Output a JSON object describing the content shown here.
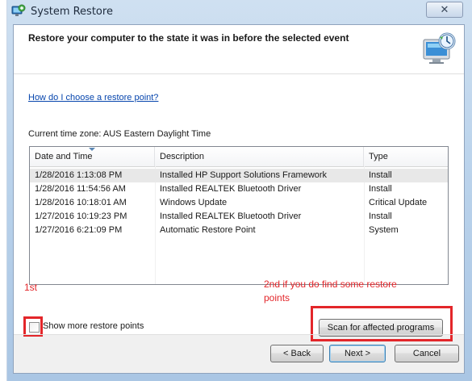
{
  "window": {
    "title": "System Restore",
    "close_glyph": "✕"
  },
  "header": {
    "title": "Restore your computer to the state it was in before the selected event"
  },
  "content": {
    "help_link": "How do I choose a restore point?",
    "timezone_label": "Current time zone: AUS Eastern Daylight Time"
  },
  "table": {
    "columns": [
      "Date and Time",
      "Description",
      "Type"
    ],
    "rows": [
      {
        "date": "1/28/2016 1:13:08 PM",
        "description": "Installed HP Support Solutions Framework",
        "type": "Install"
      },
      {
        "date": "1/28/2016 11:54:56 AM",
        "description": "Installed REALTEK Bluetooth Driver",
        "type": "Install"
      },
      {
        "date": "1/28/2016 10:18:01 AM",
        "description": "Windows Update",
        "type": "Critical Update"
      },
      {
        "date": "1/27/2016 10:19:23 PM",
        "description": "Installed REALTEK Bluetooth Driver",
        "type": "Install"
      },
      {
        "date": "1/27/2016 6:21:09 PM",
        "description": "Automatic Restore Point",
        "type": "System"
      }
    ]
  },
  "options": {
    "show_more_label": "Show more restore points",
    "show_more_checked": false,
    "scan_button": "Scan for affected programs"
  },
  "annotations": {
    "first": "1st",
    "second_line1": "2nd if you do find some restore",
    "second_line2": "points",
    "color": "#e3262a"
  },
  "footer": {
    "back": "< Back",
    "next": "Next >",
    "cancel": "Cancel"
  },
  "icons": {
    "app": "system-restore-icon",
    "header": "restore-monitor-icon",
    "close": "close-icon"
  }
}
